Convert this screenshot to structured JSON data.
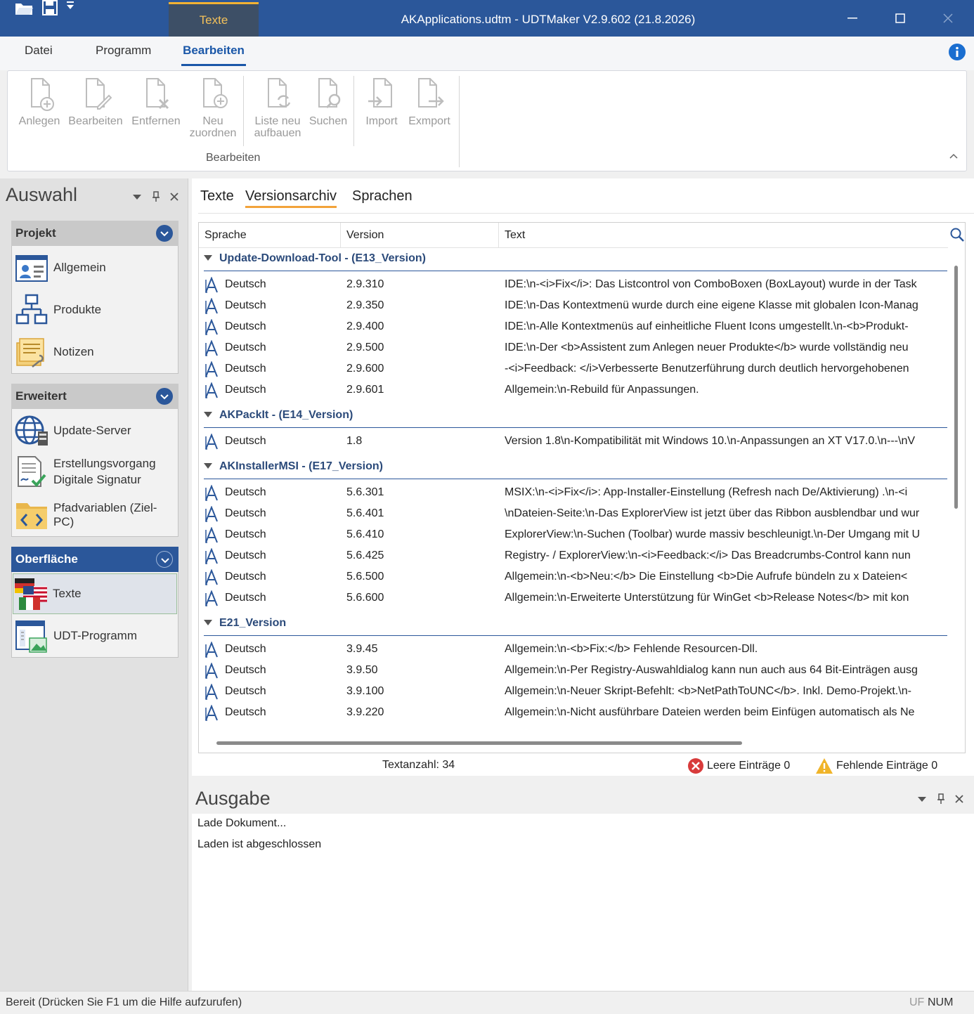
{
  "titlebar": {
    "context_tab": "Texte",
    "title": "AKApplications.udtm - UDTMaker V2.9.602 (21.8.2026)"
  },
  "ribbon": {
    "tabs": [
      "Datei",
      "Programm",
      "Bearbeiten"
    ],
    "buttons": [
      {
        "label": "Anlegen"
      },
      {
        "label": "Bearbeiten"
      },
      {
        "label": "Entfernen"
      },
      {
        "label": "Neu zuordnen"
      },
      {
        "label": "Liste neu aufbauen"
      },
      {
        "label": "Suchen"
      },
      {
        "label": "Import"
      },
      {
        "label": "Exmport"
      }
    ],
    "group_label": "Bearbeiten"
  },
  "left": {
    "title": "Auswahl",
    "groups": [
      {
        "title": "Projekt",
        "items": [
          "Allgemein",
          "Produkte",
          "Notizen"
        ]
      },
      {
        "title": "Erweitert",
        "items": [
          "Update-Server",
          "Erstellungsvorgang\nDigitale Signatur",
          "Pfadvariablen (Ziel-PC)"
        ]
      },
      {
        "title": "Oberfläche",
        "items": [
          "Texte",
          "UDT-Programm"
        ]
      }
    ]
  },
  "content": {
    "tabs": [
      "Texte",
      "Versionsarchiv",
      "Sprachen"
    ],
    "columns": [
      "Sprache",
      "Version",
      "Text"
    ],
    "groups": [
      {
        "title": "Update-Download-Tool  - (E13_Version)",
        "rows": [
          {
            "lang": "Deutsch",
            "version": "2.9.310",
            "text": "IDE:\\n-<i>Fix</i>: Das Listcontrol von ComboBoxen (BoxLayout) wurde in der Task"
          },
          {
            "lang": "Deutsch",
            "version": "2.9.350",
            "text": "IDE:\\n-Das Kontextmenü wurde durch eine eigene Klasse mit globalen Icon-Manag"
          },
          {
            "lang": "Deutsch",
            "version": "2.9.400",
            "text": "IDE:\\n-Alle Kontextmenüs auf einheitliche Fluent Icons umgestellt.\\n-<b>Produkt-"
          },
          {
            "lang": "Deutsch",
            "version": "2.9.500",
            "text": "IDE:\\n-Der <b>Assistent zum Anlegen neuer Produkte</b> wurde vollständig neu"
          },
          {
            "lang": "Deutsch",
            "version": "2.9.600",
            "text": "-<i>Feedback: </i>Verbesserte Benutzerführung durch deutlich hervorgehobenen"
          },
          {
            "lang": "Deutsch",
            "version": "2.9.601",
            "text": "Allgemein:\\n-Rebuild für Anpassungen."
          }
        ]
      },
      {
        "title": "AKPackIt  - (E14_Version)",
        "rows": [
          {
            "lang": "Deutsch",
            "version": "1.8",
            "text": "Version 1.8\\n-Kompatibilität mit Windows 10.\\n-Anpassungen an XT V17.0.\\n---\\nV"
          }
        ]
      },
      {
        "title": "AKInstallerMSI  - (E17_Version)",
        "rows": [
          {
            "lang": "Deutsch",
            "version": "5.6.301",
            "text": "MSIX:\\n-<i>Fix</i>: App-Installer-Einstellung (Refresh nach De/Aktivierung) .\\n-<i"
          },
          {
            "lang": "Deutsch",
            "version": "5.6.401",
            "text": "\\nDateien-Seite:\\n-Das ExplorerView ist jetzt über das Ribbon ausblendbar und wur"
          },
          {
            "lang": "Deutsch",
            "version": "5.6.410",
            "text": "ExplorerView:\\n-Suchen (Toolbar) wurde massiv beschleunigt.\\n-Der Umgang mit U"
          },
          {
            "lang": "Deutsch",
            "version": "5.6.425",
            "text": "Registry- / ExplorerView:\\n-<i>Feedback:</i> Das Breadcrumbs-Control kann nun"
          },
          {
            "lang": "Deutsch",
            "version": "5.6.500",
            "text": "Allgemein:\\n-<b>Neu:</b> Die Einstellung <b>Die Aufrufe bündeln zu x Dateien<"
          },
          {
            "lang": "Deutsch",
            "version": "5.6.600",
            "text": "Allgemein:\\n-Erweiterte Unterstützung für WinGet <b>Release Notes</b> mit kon"
          }
        ]
      },
      {
        "title": "E21_Version",
        "rows": [
          {
            "lang": "Deutsch",
            "version": "3.9.45",
            "text": "Allgemein:\\n-<b>Fix:</b> Fehlende Resourcen-Dll."
          },
          {
            "lang": "Deutsch",
            "version": "3.9.50",
            "text": "Allgemein:\\n-Per Registry-Auswahldialog kann nun auch aus 64 Bit-Einträgen ausg"
          },
          {
            "lang": "Deutsch",
            "version": "3.9.100",
            "text": "Allgemein:\\n-Neuer Skript-Befehlt: <b>NetPathToUNC</b>. Inkl. Demo-Projekt.\\n-"
          },
          {
            "lang": "Deutsch",
            "version": "3.9.220",
            "text": "Allgemein:\\n-Nicht ausführbare Dateien werden beim Einfügen automatisch als Ne"
          }
        ]
      }
    ],
    "count_label": "Textanzahl: 34",
    "empty_label": "Leere Einträge 0",
    "missing_label": "Fehlende Einträge 0"
  },
  "output": {
    "title": "Ausgabe",
    "lines": [
      "Lade Dokument...",
      "Laden ist abgeschlossen"
    ]
  },
  "statusbar": {
    "text": "Bereit (Drücken Sie F1 um die Hilfe aufzurufen)",
    "uf": "UF",
    "num": "NUM"
  },
  "colors": {
    "accent": "#2b579a",
    "context_tab": "#f2b233",
    "tab_underline": "#f2a33a",
    "error": "#d83b3b",
    "warning": "#f0b429"
  }
}
